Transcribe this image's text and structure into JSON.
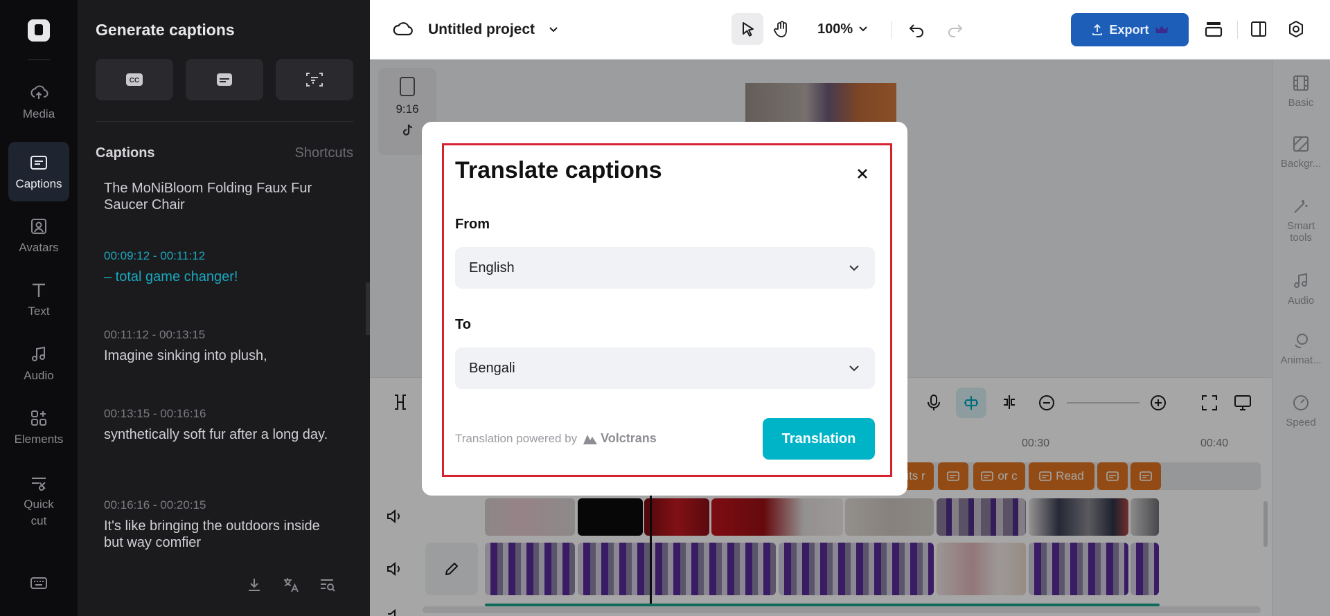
{
  "app": {
    "project_title": "Untitled project",
    "zoom": "100%",
    "export_label": "Export"
  },
  "rail": {
    "items": [
      {
        "label": "Media",
        "icon": "cloud-upload-icon"
      },
      {
        "label": "Captions",
        "icon": "captions-icon",
        "active": true
      },
      {
        "label": "Avatars",
        "icon": "avatar-icon"
      },
      {
        "label": "Text",
        "icon": "text-icon"
      },
      {
        "label": "Audio",
        "icon": "music-note-icon"
      },
      {
        "label": "Elements",
        "icon": "elements-icon"
      },
      {
        "label": "Quick cut",
        "icon": "quick-cut-icon"
      }
    ]
  },
  "captions_panel": {
    "title": "Generate captions",
    "section_title": "Captions",
    "shortcuts_label": "Shortcuts",
    "items": [
      {
        "time": "",
        "text": "The MoNiBloom Folding Faux Fur Saucer Chair",
        "active": false
      },
      {
        "time": "00:09:12 - 00:11:12",
        "text": "– total game changer!",
        "active": true
      },
      {
        "time": "00:11:12 - 00:13:15",
        "text": "Imagine sinking into plush,",
        "active": false
      },
      {
        "time": "00:13:15 - 00:16:16",
        "text": "synthetically soft fur after a long day.",
        "active": false
      },
      {
        "time": "00:16:16 - 00:20:15",
        "text": "It's like bringing the outdoors inside but way comfier",
        "active": false
      }
    ]
  },
  "canvas": {
    "ratio_label": "9:16"
  },
  "right_sidebar": {
    "items": [
      {
        "label": "Basic"
      },
      {
        "label": "Backgr..."
      },
      {
        "label": "Smart tools"
      },
      {
        "label": "Audio"
      },
      {
        "label": "Animat..."
      },
      {
        "label": "Speed"
      }
    ]
  },
  "timeline": {
    "ticks": [
      "00:30",
      "00:40"
    ],
    "caption_chips": [
      "its r",
      "",
      "or c",
      "Read",
      "",
      ""
    ]
  },
  "dialog": {
    "title": "Translate captions",
    "from_label": "From",
    "from_value": "English",
    "to_label": "To",
    "to_value": "Bengali",
    "powered_by": "Translation powered by",
    "provider": "Volctrans",
    "action_label": "Translation",
    "colors": {
      "action": "#00b4c8",
      "highlight": "#d6222f"
    }
  }
}
